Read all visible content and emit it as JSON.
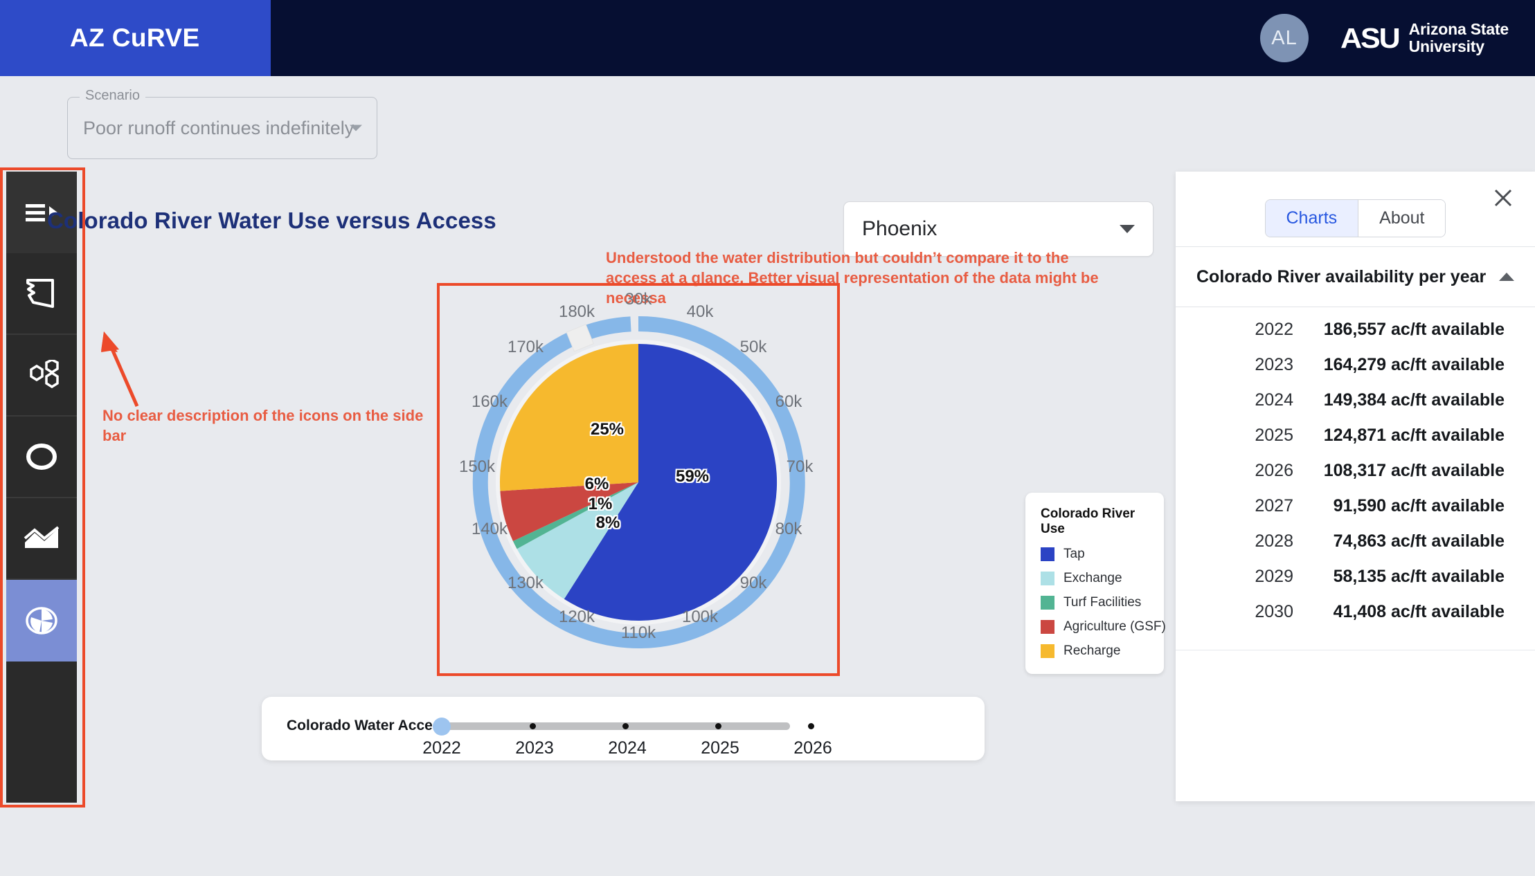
{
  "topbar": {
    "brand": "AZ CuRVE",
    "avatar_initials": "AL",
    "asu_mark": "ASU",
    "asu_line1": "Arizona State",
    "asu_line2": "University"
  },
  "scenario": {
    "legend": "Scenario",
    "value": "Poor runoff continues indefinitely"
  },
  "sidebar": {
    "items": [
      {
        "name": "menu-expand",
        "active": false
      },
      {
        "name": "arizona-outline",
        "active": false
      },
      {
        "name": "hexagon-cluster",
        "active": false
      },
      {
        "name": "ring",
        "active": false
      },
      {
        "name": "area-chart",
        "active": false
      },
      {
        "name": "pie-chart",
        "active": true
      }
    ]
  },
  "main": {
    "page_title": "Colorado River Water Use versus Access",
    "city_select_value": "Phoenix"
  },
  "annotations": [
    {
      "id": "chart-note",
      "text": "Understood the water distribution but couldn’t compare it to the access at a glance. Better visual representation of the data might be necessa"
    },
    {
      "id": "sidebar-note",
      "text": "No clear description of the icons on the side bar"
    }
  ],
  "legend": {
    "title": "Colorado River Use",
    "items": [
      {
        "label": "Tap",
        "color": "#2b43c4"
      },
      {
        "label": "Exchange",
        "color": "#ade0e6"
      },
      {
        "label": "Turf Facilities",
        "color": "#52b493"
      },
      {
        "label": "Agriculture (GSF)",
        "color": "#cb4741"
      },
      {
        "label": "Recharge",
        "color": "#f6b92e"
      }
    ]
  },
  "slider": {
    "label": "Colorado Water Access",
    "ticks": [
      "2022",
      "2023",
      "2024",
      "2025",
      "2026"
    ],
    "value": "2022"
  },
  "right_panel": {
    "tabs": [
      {
        "label": "Charts",
        "active": true
      },
      {
        "label": "About",
        "active": false
      }
    ],
    "close_label": "×",
    "section_title": "Colorado River availability per year",
    "rows": [
      {
        "year": "2022",
        "value": "186,557 ac/ft available"
      },
      {
        "year": "2023",
        "value": "164,279 ac/ft available"
      },
      {
        "year": "2024",
        "value": "149,384 ac/ft available"
      },
      {
        "year": "2025",
        "value": "124,871 ac/ft available"
      },
      {
        "year": "2026",
        "value": "108,317 ac/ft available"
      },
      {
        "year": "2027",
        "value": "91,590 ac/ft available"
      },
      {
        "year": "2028",
        "value": "74,863 ac/ft available"
      },
      {
        "year": "2029",
        "value": "58,135 ac/ft available"
      },
      {
        "year": "2030",
        "value": "41,408 ac/ft available"
      }
    ]
  },
  "chart_data": {
    "type": "pie",
    "title": "Colorado River Water Use versus Access",
    "categories": [
      "Tap",
      "Exchange",
      "Turf Facilities",
      "Agriculture (GSF)",
      "Recharge"
    ],
    "values": [
      59,
      8,
      1,
      6,
      25
    ],
    "value_labels": [
      "59%",
      "8%",
      "1%",
      "6%",
      "25%"
    ],
    "colors": [
      "#2b43c4",
      "#ade0e6",
      "#52b493",
      "#cb4741",
      "#f6b92e"
    ],
    "legend_position": "right",
    "gauge": {
      "description": "Outer ring gauge showing Colorado River access in acre-feet; light blue arc with a white square marker near 180k",
      "tick_labels": [
        "30k",
        "40k",
        "50k",
        "60k",
        "70k",
        "80k",
        "90k",
        "100k",
        "110k",
        "120k",
        "130k",
        "140k",
        "150k",
        "160k",
        "170k",
        "180k"
      ],
      "range_min": 30000,
      "range_max": 186557,
      "marker_value": "186,557",
      "arc_color": "#86b7e8",
      "marker_color": "#f0f0f0"
    }
  },
  "colors": {
    "brand_blue": "#2e4bc8",
    "header_navy": "#060f32",
    "accent_red": "#ec4a2a",
    "title_navy": "#1d3078",
    "sidebar_active": "#7b8ed4",
    "tab_active_text": "#2757e0"
  }
}
